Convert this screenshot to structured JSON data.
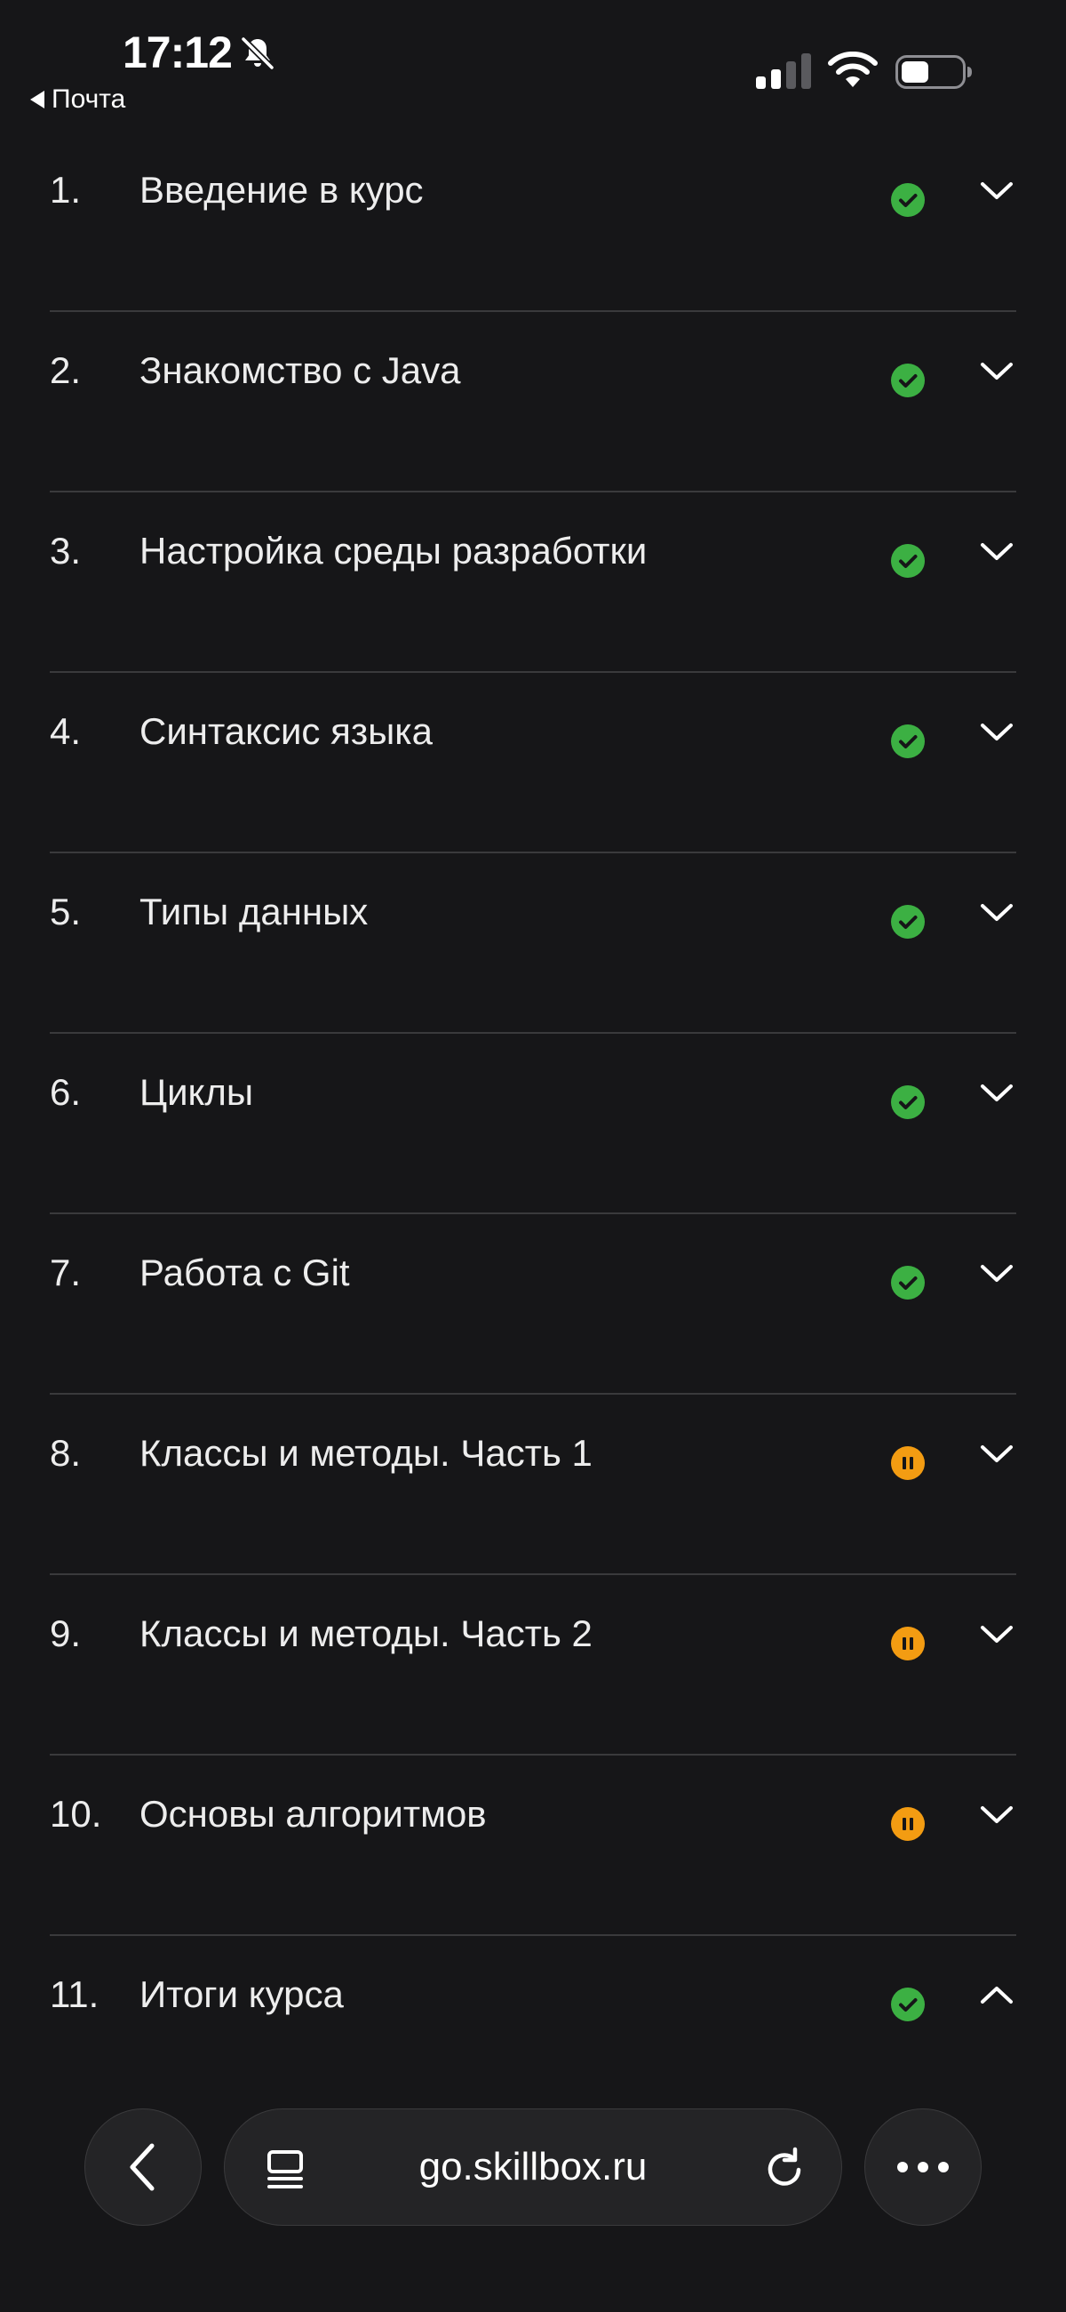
{
  "status_bar": {
    "time": "17:12",
    "back_app_label": "Почта",
    "icons": [
      "bell-slash-icon",
      "cellular-signal-icon",
      "wifi-icon",
      "battery-icon"
    ]
  },
  "modules": [
    {
      "number": "1.",
      "title": "Введение в курс",
      "status": "completed",
      "expanded": false
    },
    {
      "number": "2.",
      "title": "Знакомство с Java",
      "status": "completed",
      "expanded": false
    },
    {
      "number": "3.",
      "title": "Настройка среды разработки",
      "status": "completed",
      "expanded": false
    },
    {
      "number": "4.",
      "title": "Синтаксис языка",
      "status": "completed",
      "expanded": false
    },
    {
      "number": "5.",
      "title": "Типы данных",
      "status": "completed",
      "expanded": false
    },
    {
      "number": "6.",
      "title": "Циклы",
      "status": "completed",
      "expanded": false
    },
    {
      "number": "7.",
      "title": "Работа с Git",
      "status": "completed",
      "expanded": false
    },
    {
      "number": "8.",
      "title": "Классы и методы. Часть 1",
      "status": "paused",
      "expanded": false
    },
    {
      "number": "9.",
      "title": "Классы и методы. Часть 2",
      "status": "paused",
      "expanded": false
    },
    {
      "number": "10.",
      "title": "Основы алгоритмов",
      "status": "paused",
      "expanded": false
    },
    {
      "number": "11.",
      "title": "Итоги курса",
      "status": "completed",
      "expanded": true
    }
  ],
  "browser": {
    "url": "go.skillbox.ru",
    "icons": [
      "chevron-left-icon",
      "tabs-icon",
      "reload-icon",
      "more-icon"
    ]
  },
  "colors": {
    "background": "#161618",
    "completed": "#3cb043",
    "paused": "#f39c12",
    "divider": "#3a3a3c"
  }
}
